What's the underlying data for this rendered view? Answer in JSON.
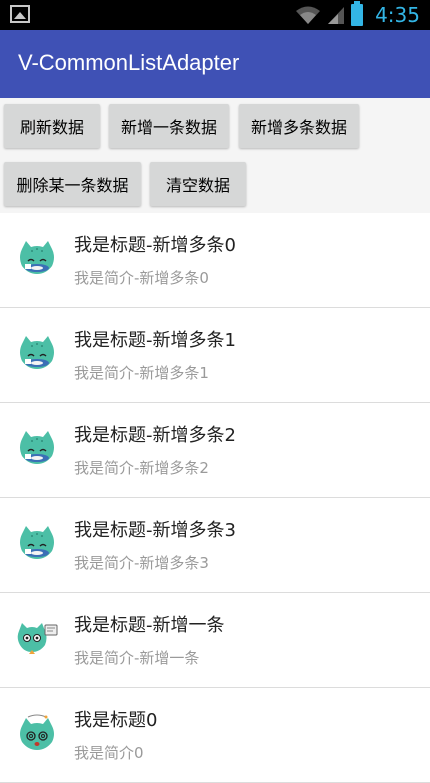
{
  "status_bar": {
    "time": "4:35",
    "notification_icon": "gallery-icon",
    "battery_color": "#33b5e5"
  },
  "app_bar": {
    "title": "V-CommonListAdapter",
    "color": "#3f51b5"
  },
  "buttons": {
    "refresh": "刷新数据",
    "add_one": "新增一条数据",
    "add_many": "新增多条数据",
    "delete_one": "删除某一条数据",
    "clear": "清空数据"
  },
  "list": {
    "items": [
      {
        "title": "我是标题-新增多条0",
        "desc": "我是简介-新增多条0",
        "icon": "cat-fish-icon"
      },
      {
        "title": "我是标题-新增多条1",
        "desc": "我是简介-新增多条1",
        "icon": "cat-fish-icon"
      },
      {
        "title": "我是标题-新增多条2",
        "desc": "我是简介-新增多条2",
        "icon": "cat-fish-icon"
      },
      {
        "title": "我是标题-新增多条3",
        "desc": "我是简介-新增多条3",
        "icon": "cat-fish-icon"
      },
      {
        "title": "我是标题-新增一条",
        "desc": "我是简介-新增一条",
        "icon": "cat-speech-icon"
      },
      {
        "title": "我是标题0",
        "desc": "我是简介0",
        "icon": "cat-dizzy-icon"
      }
    ]
  }
}
